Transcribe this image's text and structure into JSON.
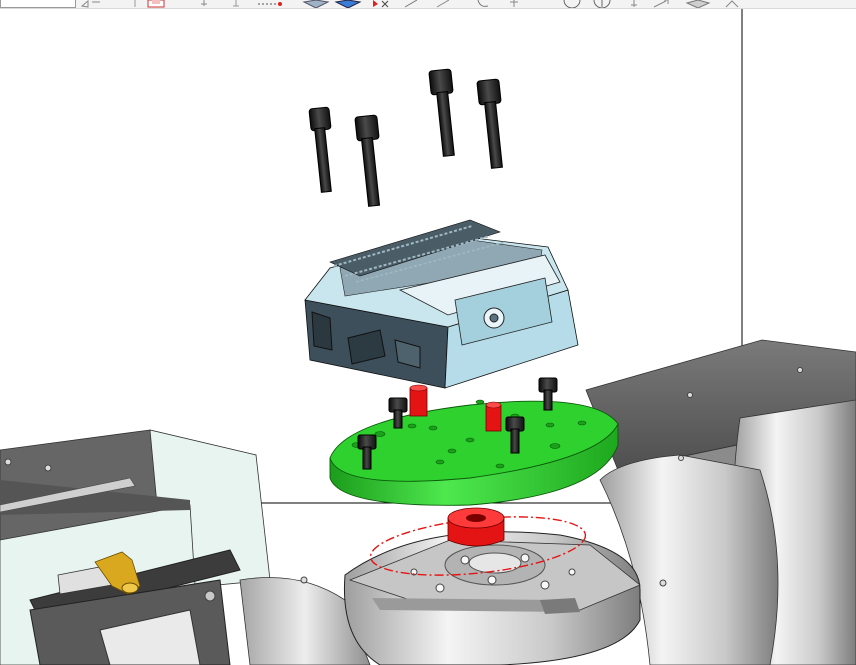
{
  "toolbar": {
    "search": {
      "value": "",
      "placeholder": ""
    },
    "tools": [
      "view-options-icon",
      "pointer-icon",
      "sketch-icon",
      "snap-point-icon",
      "filter-icon",
      "dotted-line-icon",
      "solid-view-icon",
      "shaded-view-icon",
      "select-arrow-icon",
      "line-icon",
      "arc-icon",
      "trim-icon",
      "circle-icon",
      "circle-3pt-icon",
      "axis-icon",
      "edit-icon",
      "plane-icon",
      "view-cube-icon"
    ]
  },
  "viewport": {
    "description_free": true,
    "colors": {
      "background": "#ffffff",
      "vise_body": "#b5dce8",
      "vise_dark": "#3d4f5a",
      "fixture_plate": "#2fd12f",
      "dowel_pins": "#e51414",
      "bolts": "#1e1e1e",
      "rotary_table": "#d8d8d8",
      "machine_housing": "#6b6b6b",
      "coolant_block": "#e8f4ef",
      "fitting": "#d9a81e",
      "datum_circle": "#e51414"
    }
  }
}
